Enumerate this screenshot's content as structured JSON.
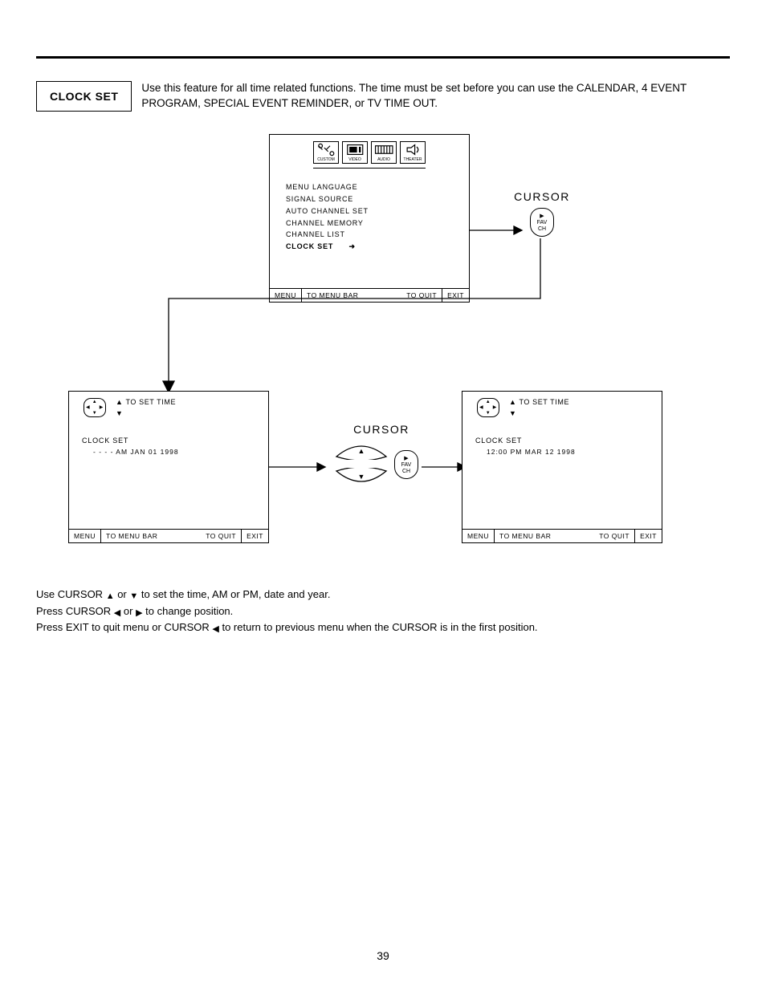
{
  "title": "CLOCK SET",
  "intro": "Use this feature for all time related functions.  The time must be set before you can use the CALENDAR, 4 EVENT PROGRAM, SPECIAL EVENT REMINDER, or TV TIME OUT.",
  "tabs": {
    "custom": "CUSTOM",
    "video": "VIDEO",
    "audio": "AUDIO",
    "theater": "THEATER"
  },
  "menu": {
    "items": [
      "MENU LANGUAGE",
      "SIGNAL SOURCE",
      "AUTO CHANNEL SET",
      "CHANNEL MEMORY",
      "CHANNEL LIST"
    ],
    "active": "CLOCK SET"
  },
  "footer": {
    "menu": "MENU",
    "to_menu_bar": "TO MENU BAR",
    "to_quit": "TO QUIT",
    "exit": "EXIT"
  },
  "cursor_label": "CURSOR",
  "fav": {
    "line1": "FAV",
    "line2": "CH"
  },
  "set_time_label": "TO SET TIME",
  "clock_set_heading": "CLOCK SET",
  "clock_left_value": "- -  - - AM JAN 01 1998",
  "clock_right_value": "12:00 PM MAR 12 1998",
  "instructions": {
    "l1a": "Use CURSOR ",
    "l1b": " or ",
    "l1c": " to set the time, AM or PM, date and year.",
    "l2a": "Press CURSOR ",
    "l2b": " or ",
    "l2c": " to change position.",
    "l3a": "Press EXIT to quit menu or CURSOR ",
    "l3b": " to return to previous menu when the CURSOR is in the first position."
  },
  "page_number": "39"
}
